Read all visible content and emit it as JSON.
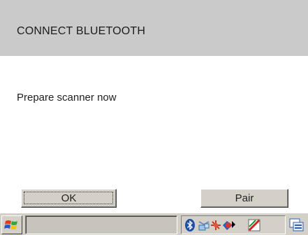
{
  "header": {
    "title": "CONNECT BLUETOOTH"
  },
  "message": "Prepare scanner now",
  "buttons": {
    "ok": "OK",
    "pair": "Pair"
  },
  "taskbar": {
    "start_icon": "windows-flag-icon",
    "tray_icons": [
      "bluetooth-icon",
      "network-icon",
      "connection-icon",
      "security-icon",
      "chevron-right-icon",
      "flag-icon"
    ],
    "sip_icon": "keyboard-icon"
  },
  "colors": {
    "header_bg": "#cacaca",
    "button_face": "#d4d0c8",
    "bluetooth_blue": "#1f4ea8"
  }
}
